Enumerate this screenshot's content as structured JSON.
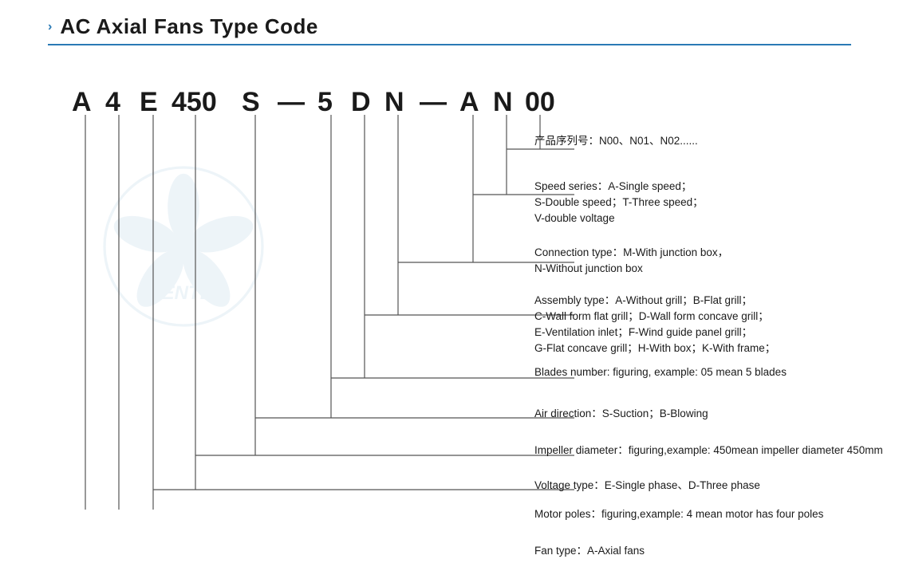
{
  "header": {
    "chevron": "›",
    "title": "AC Axial Fans Type Code",
    "divider": true
  },
  "type_code": {
    "chars": [
      "A",
      "4",
      "E",
      "450",
      "S",
      "—",
      "5",
      "D",
      "N",
      "—",
      "A",
      "N",
      "00"
    ]
  },
  "labels": {
    "product_series": "产品序列号：N00、N01、N02......",
    "speed_series_line1": "Speed series：A-Single speed；",
    "speed_series_line2": "S-Double speed；T-Three speed；",
    "speed_series_line3": "V-double voltage",
    "connection_type_line1": "Connection type：M-With junction box，",
    "connection_type_line2": "N-Without junction box",
    "assembly_line1": "Assembly type：A-Without grill；B-Flat grill；",
    "assembly_line2": "C-Wall form flat grill；D-Wall form concave grill；",
    "assembly_line3": "E-Ventilation inlet；F-Wind guide panel grill；",
    "assembly_line4": "G-Flat concave grill；H-With box；K-With frame；",
    "blades_number": "Blades number: figuring, example: 05 mean 5 blades",
    "air_direction": "Air direction：S-Suction；B-Blowing",
    "impeller_diameter": "Impeller diameter：figuring,example: 450mean impeller diameter 450mm",
    "voltage_type": "Voltage type：E-Single phase、D-Three phase",
    "motor_poles": "Motor poles：figuring,example: 4 mean motor has four poles",
    "fan_type": "Fan type：A-Axial fans"
  }
}
